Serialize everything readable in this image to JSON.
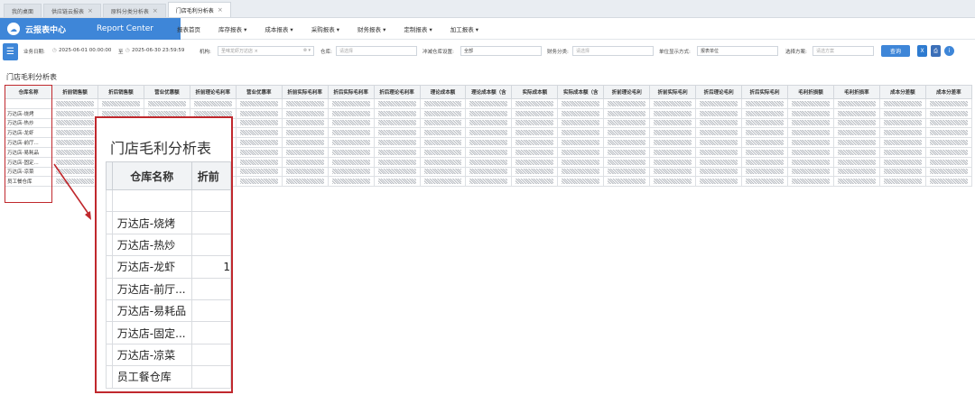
{
  "tabs": [
    "我的桌面",
    "供应链云报表",
    "原料分类分析表",
    "门店毛利分析表"
  ],
  "brand": {
    "cn": "云报表中心",
    "en": "Report Center"
  },
  "nav": [
    "报表首页",
    "库存报表 ▾",
    "成本报表 ▾",
    "采购报表 ▾",
    "财务报表 ▾",
    "定制报表 ▾",
    "加工报表 ▾"
  ],
  "filters": {
    "date_label": "业务日期:",
    "date_start": "2025-06-01 00:00:00",
    "date_to": "至",
    "date_end": "2025-06-30 23:59:59",
    "org_label": "机构:",
    "org_value": "圣味龙虾万达店 ×",
    "org_dd": "⊗ ▾",
    "warehouse_label": "仓库:",
    "warehouse_placeholder": "请选择",
    "transit_label": "冲减仓库设置:",
    "transit_value": "全部",
    "finance_label": "财务分类:",
    "finance_placeholder": "请选择",
    "unit_label": "单位显示方式:",
    "unit_value": "报表单位",
    "scheme_label": "选择方案:",
    "scheme_placeholder": "请选方案",
    "query_label": "查询"
  },
  "report_title": "门店毛利分析表",
  "columns": [
    "仓库名称",
    "折前销售额",
    "折后销售额",
    "营业优惠额",
    "折前理论毛利率",
    "营业优惠率",
    "折前实际毛利率",
    "折后实际毛利率",
    "折后理论毛利率",
    "理论成本额",
    "理论成本额（含",
    "实际成本额",
    "实际成本额（含",
    "折前理论毛利",
    "折前实际毛利",
    "折后理论毛利",
    "折后实际毛利",
    "毛利折损额",
    "毛利折损率",
    "成本分差额",
    "成本分差率"
  ],
  "rows": [
    "",
    "万达店-烧烤",
    "万达店-热炒",
    "万达店-龙虾",
    "万达店-前厅...",
    "万达店-易耗品",
    "万达店-固定...",
    "万达店-凉菜",
    "员工餐仓库"
  ],
  "zoom": {
    "title": "门店毛利分析表",
    "col1": "仓库名称",
    "col2": "折前",
    "peek_value": "1"
  },
  "colors": {
    "accent": "#3e86d8",
    "highlight": "#c0282d"
  }
}
